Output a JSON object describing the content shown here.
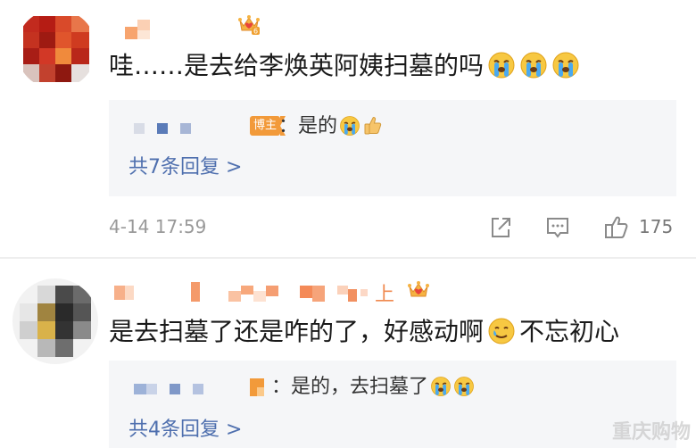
{
  "comments": [
    {
      "text": "哇……是去给李焕英阿姨扫墓的吗",
      "emojis": [
        "crying-face",
        "crying-face",
        "crying-face"
      ],
      "crown_level": "6",
      "reply": {
        "badge": "博主",
        "text": "：是的",
        "emojis": [
          "crying-face",
          "thumbs-up"
        ]
      },
      "more_replies": "共7条回复 >",
      "time": "4-14 17:59",
      "likes": "175"
    },
    {
      "text": "是去扫墓了还是咋的了，好感动啊",
      "text_suffix": "不忘初心",
      "emojis": [
        "tearful-smile"
      ],
      "username_tail": "上",
      "reply": {
        "text": "：是的，去扫墓了",
        "emojis": [
          "crying-face",
          "crying-face"
        ]
      },
      "more_replies": "共4条回复 >"
    }
  ],
  "watermark": "重庆购物",
  "colors": {
    "badge": "#f29a3a",
    "link": "#4e6fae",
    "reply_bg": "#f5f6f8"
  }
}
